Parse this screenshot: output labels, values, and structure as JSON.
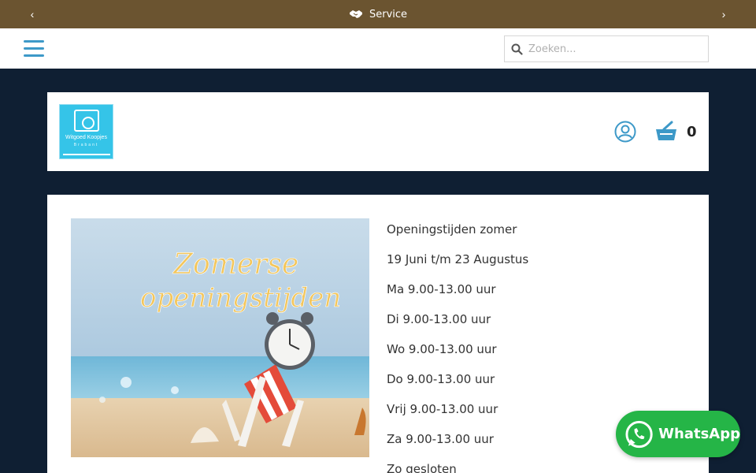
{
  "topbar": {
    "prev_arrow": "‹",
    "next_arrow": "›",
    "service_icon": "handshake-icon",
    "service_label": "Service"
  },
  "navbar": {
    "menu_icon": "hamburger-menu-icon",
    "search": {
      "placeholder": "Zoeken...",
      "value": "",
      "icon": "search-icon"
    }
  },
  "header": {
    "logo": {
      "title": "Witgoed Koopjes",
      "subtitle": "Brabant"
    },
    "user_icon": "user-account-icon",
    "cart_icon": "shopping-basket-icon",
    "cart_count": "0"
  },
  "content": {
    "hero_image": {
      "text_line1": "Zomerse",
      "text_line2": "openingstijden"
    },
    "hours": [
      "Openingstijden zomer",
      "19 Juni t/m 23 Augustus",
      "Ma 9.00-13.00 uur",
      "Di 9.00-13.00 uur",
      "Wo 9.00-13.00 uur",
      "Do 9.00-13.00 uur",
      "Vrij 9.00-13.00 uur",
      "Za 9.00-13.00 uur",
      "Zo gesloten"
    ]
  },
  "whatsapp": {
    "label": "WhatsApp",
    "icon": "whatsapp-icon"
  },
  "colors": {
    "topbar_bg": "#6b5430",
    "page_bg": "#0f1f33",
    "accent_blue": "#3d99c8",
    "whatsapp_green": "#25b547"
  }
}
